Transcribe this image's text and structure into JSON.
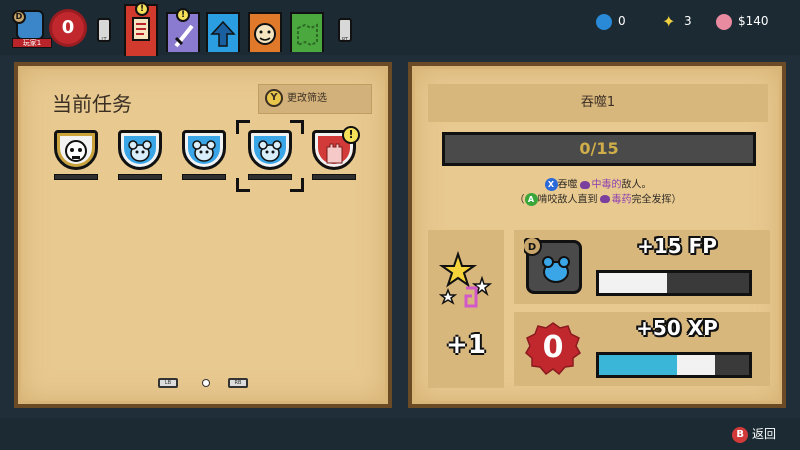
{
  "topbar": {
    "player_tag": "玩家1",
    "player_badge": "D",
    "level": "0",
    "lt_label": "LT",
    "rt_label": "RT",
    "tabs": [
      {
        "name": "quests",
        "icon": "quest-scroll-icon",
        "color": "#d23a2e",
        "active": true,
        "alert": "!"
      },
      {
        "name": "weapons",
        "icon": "sword-icon",
        "color": "#8a7ad0",
        "active": false,
        "alert": "!"
      },
      {
        "name": "upgrades",
        "icon": "arrow-up-icon",
        "color": "#2a9ee0",
        "active": false
      },
      {
        "name": "pets",
        "icon": "monkey-face-icon",
        "color": "#e07a2a",
        "active": false
      },
      {
        "name": "map",
        "icon": "map-icon",
        "color": "#4aa83e",
        "active": false
      }
    ],
    "currencies": [
      {
        "icon": "upgrade-point-icon",
        "value": "0",
        "color": "#2a8ad8"
      },
      {
        "icon": "star-burst-icon",
        "value": "3",
        "color": "#f0d040"
      },
      {
        "icon": "piggy-bank-icon",
        "value": "$140",
        "color": "#e88aa0"
      }
    ]
  },
  "left_panel": {
    "title": "当前任务",
    "filter_button": "Y",
    "filter_label": "更改筛选",
    "quests": [
      {
        "icon": "skull-face-icon",
        "shield_color": "#f2f2f2",
        "frame_color": "#c9a23a",
        "selected": false
      },
      {
        "icon": "rat-icon",
        "shield_color": "#3aa6e8",
        "frame_color": "#f2f2f2",
        "selected": false
      },
      {
        "icon": "rat-icon",
        "shield_color": "#3aa6e8",
        "frame_color": "#f2f2f2",
        "selected": false
      },
      {
        "icon": "rat-icon",
        "shield_color": "#3aa6e8",
        "frame_color": "#f2f2f2",
        "selected": true
      },
      {
        "icon": "castle-icon",
        "shield_color": "#d23a3a",
        "frame_color": "#f2f2f2",
        "selected": false,
        "alert": "!"
      }
    ],
    "page_lb": "LB",
    "page_rb": "RB"
  },
  "right_panel": {
    "quest_name": "吞噬1",
    "progress": "0/15",
    "desc_line1_btn": "X",
    "desc_line1_a": "吞噬",
    "desc_line1_poison": "中毒的",
    "desc_line1_b": "敌人。",
    "desc_line2_open": "（",
    "desc_line2_btn": "A",
    "desc_line2_a": "啃咬敌人直到",
    "desc_line2_poison": "毒药",
    "desc_line2_b": "完全发挥）",
    "reward_count": "+1",
    "fp_label": "+15 FP",
    "fp_fill": 0.45,
    "xp_label": "+50 XP",
    "xp_level": "0",
    "xp_fill_cyan": 0.52,
    "xp_fill_white": 0.25
  },
  "bottombar": {
    "back_btn": "B",
    "back_label": "返回"
  }
}
